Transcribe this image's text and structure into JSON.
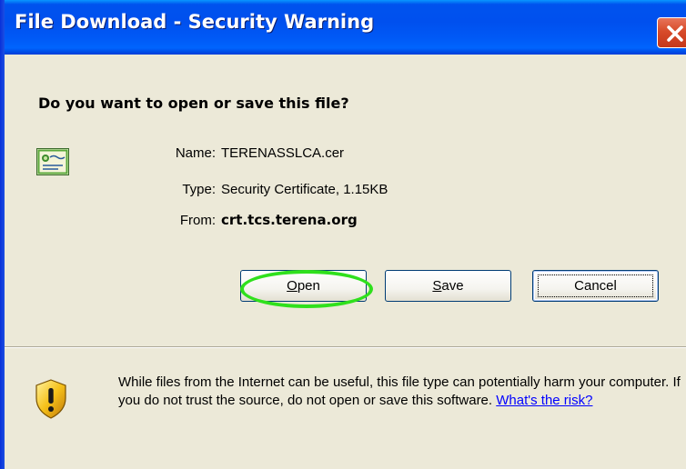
{
  "window": {
    "title": "File Download - Security Warning",
    "close_icon": "close-x-icon"
  },
  "dialog": {
    "question": "Do you want to open or save this file?",
    "file_icon": "certificate-icon",
    "name_label": "Name:",
    "name_value": "TERENASSLCA.cer",
    "type_label": "Type:",
    "type_value": "Security Certificate, 1.15KB",
    "from_label": "From:",
    "from_value": "crt.tcs.terena.org"
  },
  "buttons": {
    "open_mnemonic": "O",
    "open_rest": "pen",
    "save_mnemonic": "S",
    "save_rest": "ave",
    "cancel_label": "Cancel"
  },
  "warning": {
    "icon": "shield-warning-icon",
    "text": "While files from the Internet can be useful, this file type can potentially harm your computer. If you do not trust the source, do not open or save this software.",
    "link": "What's the risk?"
  },
  "colors": {
    "titlebar": "#0053ee",
    "dialog_bg": "#ece9d8",
    "close_button": "#d74b2a",
    "highlight": "#2fe01c",
    "link": "#0000ff"
  }
}
